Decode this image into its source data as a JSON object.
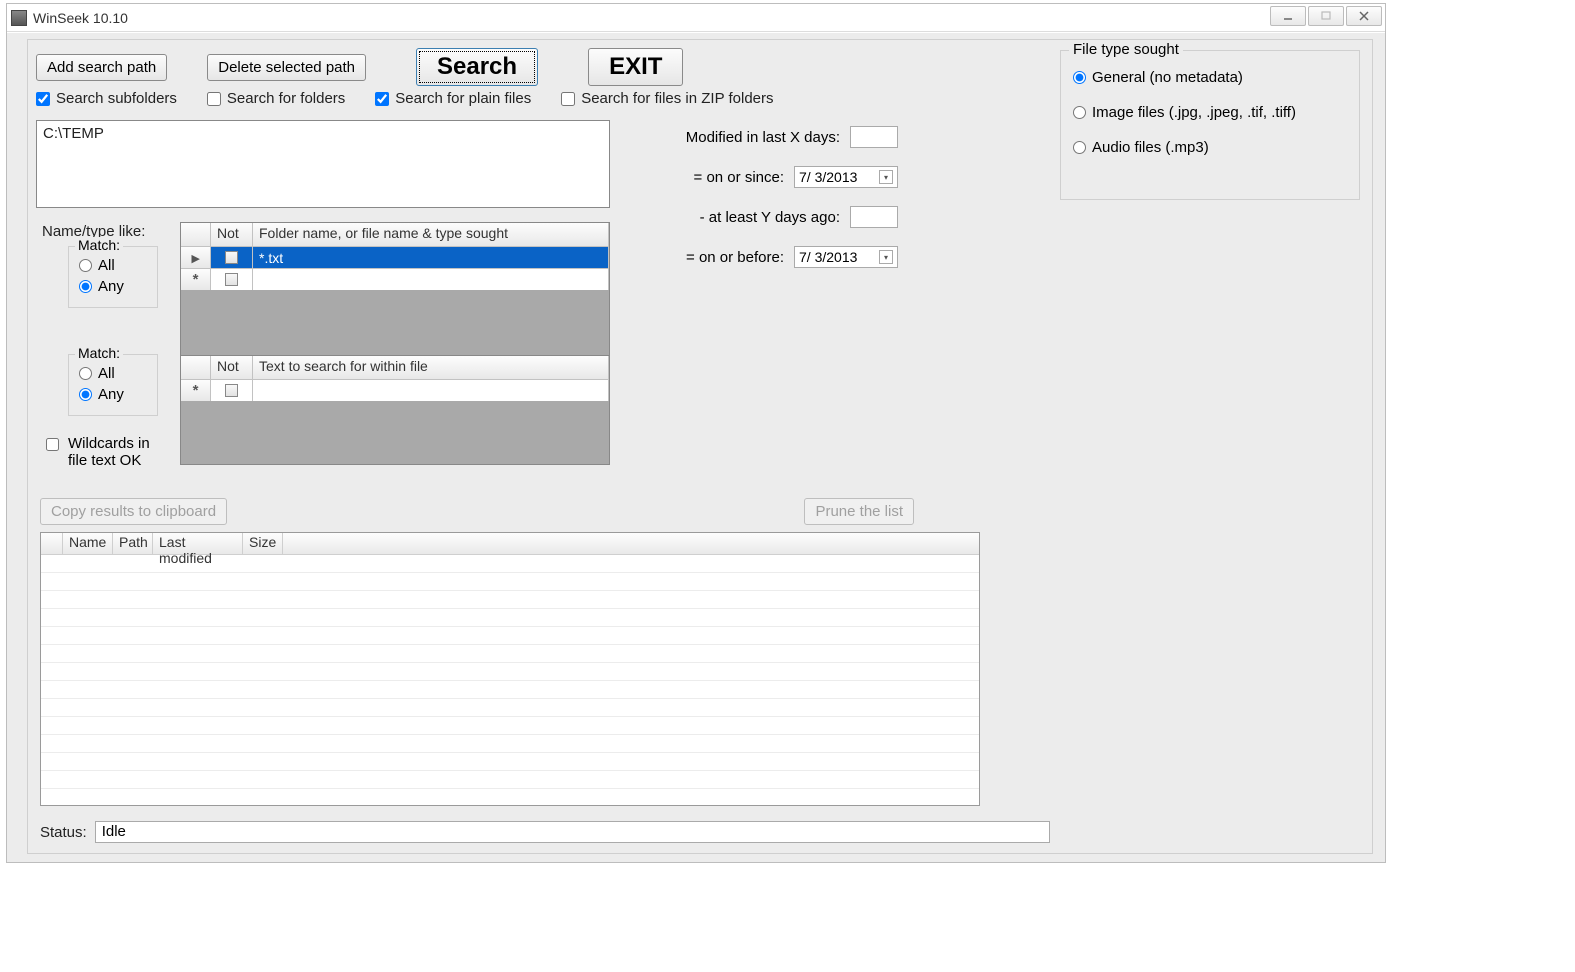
{
  "window": {
    "title": "WinSeek  10.10"
  },
  "toolbar": {
    "add_path": "Add search path",
    "delete_path": "Delete selected path",
    "search": "Search",
    "exit": "EXIT"
  },
  "options": {
    "search_subfolders": "Search subfolders",
    "search_folders": "Search for folders",
    "search_plain": "Search for plain files",
    "search_zip": "Search for files in ZIP folders"
  },
  "paths": {
    "value": "C:\\TEMP"
  },
  "name_type": {
    "label": "Name/type like:",
    "match_label": "Match:",
    "all": "All",
    "any": "Any",
    "col_not": "Not",
    "col_text": "Folder name, or file name & type sought",
    "row0": "*.txt"
  },
  "text_search": {
    "match_label": "Match:",
    "all": "All",
    "any": "Any",
    "col_not": "Not",
    "col_text": "Text to search for within file"
  },
  "wildcards": {
    "label": "Wildcards in\nfile text OK"
  },
  "dates": {
    "mod_last_x": "Modified in last X days:",
    "on_or_since": "= on or since:",
    "at_least_y": "- at least Y days ago:",
    "on_or_before": "= on or before:",
    "since_value": "7/  3/2013",
    "before_value": "7/  3/2013"
  },
  "filetype": {
    "title": "File type sought",
    "general": "General (no metadata)",
    "image": "Image files (.jpg, .jpeg, .tif, .tiff)",
    "audio": "Audio files (.mp3)"
  },
  "mid": {
    "copy": "Copy results to clipboard",
    "prune": "Prune the list"
  },
  "results": {
    "cols": {
      "name": "Name",
      "path": "Path",
      "last_mod": "Last modified",
      "size": "Size"
    }
  },
  "status": {
    "label": "Status:",
    "value": "Idle"
  }
}
